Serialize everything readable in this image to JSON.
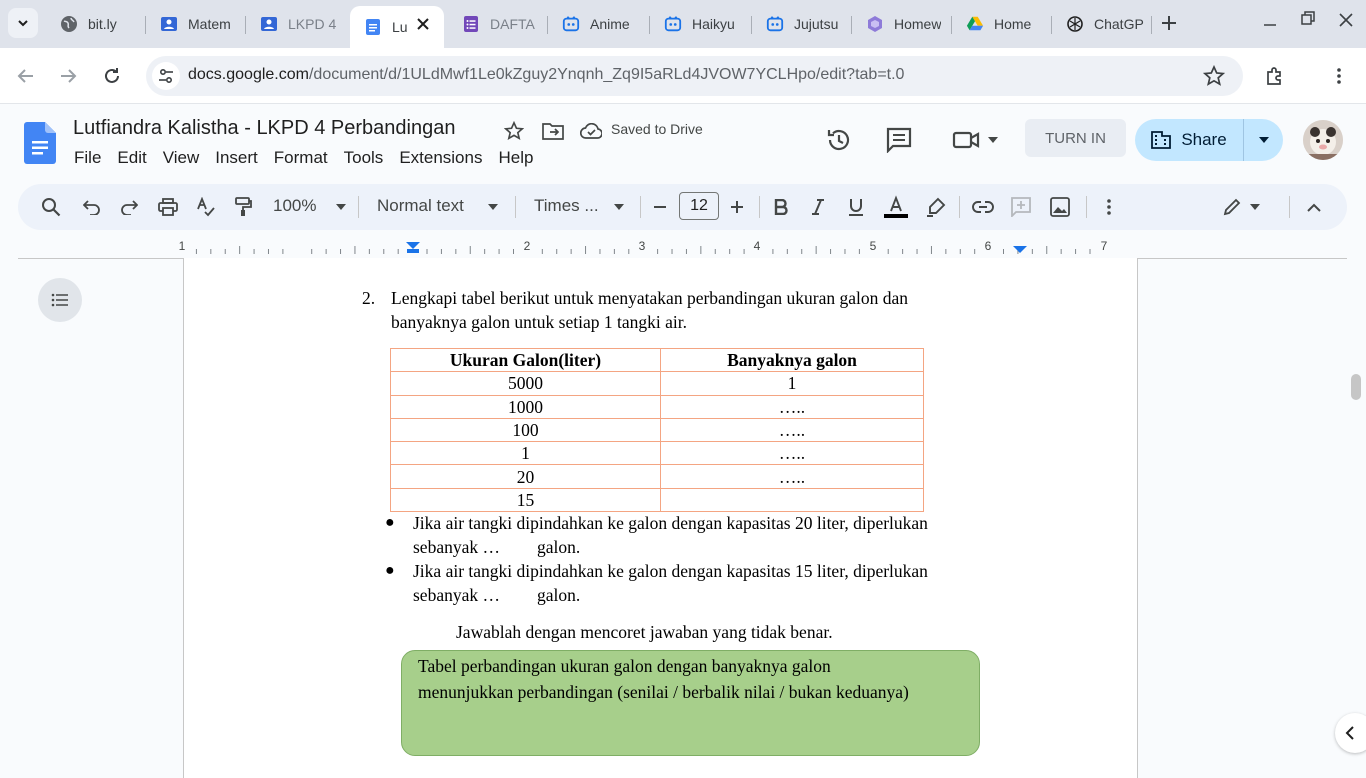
{
  "browser": {
    "tabs": [
      {
        "title": "bit.ly",
        "icon": "globe-icon"
      },
      {
        "title": "Matem",
        "icon": "classroom-icon"
      },
      {
        "title": "LKPD 4",
        "icon": "classroom-icon"
      },
      {
        "title": "Lu",
        "icon": "docs-icon",
        "active": true
      },
      {
        "title": "DAFTA",
        "icon": "forms-icon"
      },
      {
        "title": "Anime",
        "icon": "bot-icon"
      },
      {
        "title": "Haikyu",
        "icon": "bot-icon"
      },
      {
        "title": "Jujutsu",
        "icon": "bot-icon"
      },
      {
        "title": "Homew",
        "icon": "hexagon-icon"
      },
      {
        "title": "Home",
        "icon": "drive-icon"
      },
      {
        "title": "ChatGP",
        "icon": "chatgpt-icon"
      }
    ],
    "url_host": "docs.google.com",
    "url_path": "/document/d/1ULdMwf1Le0kZguy2Ynqnh_Zq9I5aRLd4JVOW7YCLHpo/edit?tab=t.0"
  },
  "docs": {
    "title": "Lutfiandra Kalistha - LKPD 4 Perbandingan",
    "saved_status": "Saved to Drive",
    "menu": [
      "File",
      "Edit",
      "View",
      "Insert",
      "Format",
      "Tools",
      "Extensions",
      "Help"
    ],
    "turn_in_label": "TURN IN",
    "share_label": "Share",
    "toolbar": {
      "zoom": "100%",
      "style": "Normal text",
      "font": "Times ...",
      "font_size": "12"
    },
    "ruler_numbers": [
      "1",
      "1",
      "2",
      "3",
      "4",
      "5",
      "6",
      "7"
    ]
  },
  "content": {
    "q_number": "2.",
    "q_line1": "Lengkapi tabel berikut untuk menyatakan perbandingan ukuran galon dan",
    "q_line2": "banyaknya galon untuk setiap 1 tangki air.",
    "table_headers": [
      "Ukuran Galon(liter)",
      "Banyaknya galon"
    ],
    "table_rows": [
      [
        "5000",
        "1"
      ],
      [
        "1000",
        "….."
      ],
      [
        "100",
        "….."
      ],
      [
        "1",
        "….."
      ],
      [
        "20",
        "….."
      ],
      [
        "15",
        ""
      ]
    ],
    "bullet1_line1": "Jika air tangki dipindahkan ke galon dengan kapasitas 20 liter, diperlukan",
    "bullet1_line2a": "sebanyak …",
    "bullet1_line2b": "galon.",
    "bullet2_line1": "Jika air tangki dipindahkan ke galon dengan kapasitas 15 liter, diperlukan",
    "bullet2_line2a": "sebanyak …",
    "bullet2_line2b": "galon.",
    "instruction": "Jawablah dengan mencoret jawaban yang tidak benar.",
    "box_line1": "Tabel perbandingan ukuran galon dengan banyaknya galon",
    "box_line2": "menunjukkan perbandingan (senilai / berbalik nilai / bukan keduanya)"
  },
  "colors": {
    "docs_blue": "#4285f4",
    "table_border": "#f4a582",
    "answer_box": "#a7cf8b",
    "share_bg": "#c2e7ff"
  }
}
